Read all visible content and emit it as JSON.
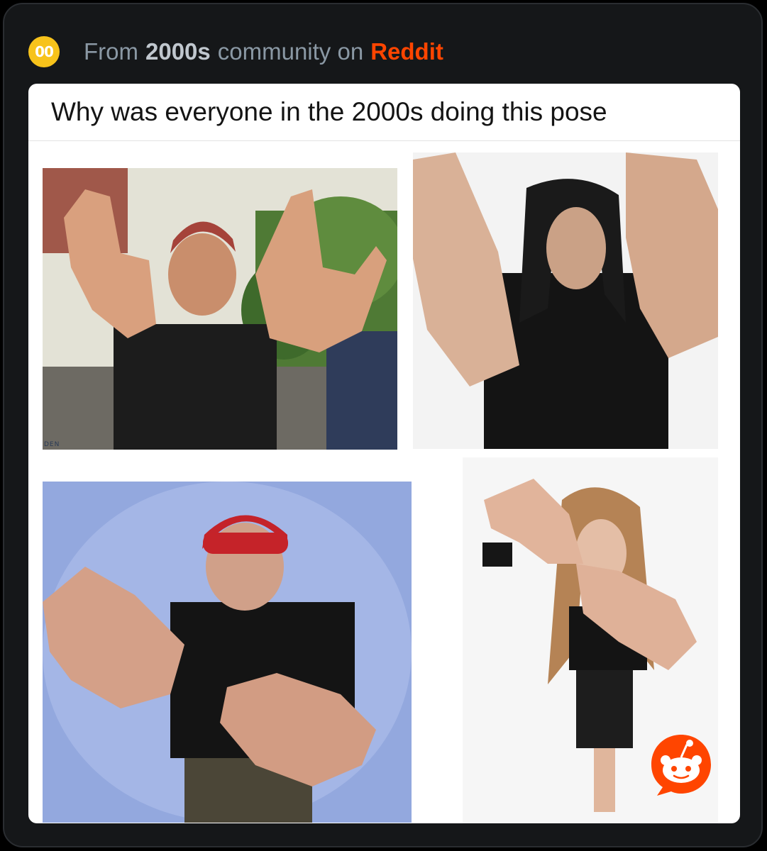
{
  "header": {
    "community_icon_label": "00",
    "prefix": "From",
    "community": "2000s",
    "mid": "community on",
    "brand": "Reddit"
  },
  "post": {
    "title": "Why was everyone in the 2000s doing this pose"
  },
  "photos": [
    {
      "name": "photo-man-red-hair",
      "overlay_text": "DEN"
    },
    {
      "name": "photo-man-dreadlocks"
    },
    {
      "name": "photo-man-red-cap"
    },
    {
      "name": "photo-woman-long-hair"
    }
  ],
  "colors": {
    "background": "#151719",
    "card": "#ffffff",
    "brand": "#ff4500",
    "community_icon": "#f7c31b",
    "muted_text": "#8a98a4"
  },
  "icons": {
    "community": "community-avatar-icon",
    "badge": "reddit-snoo-chat-icon"
  }
}
